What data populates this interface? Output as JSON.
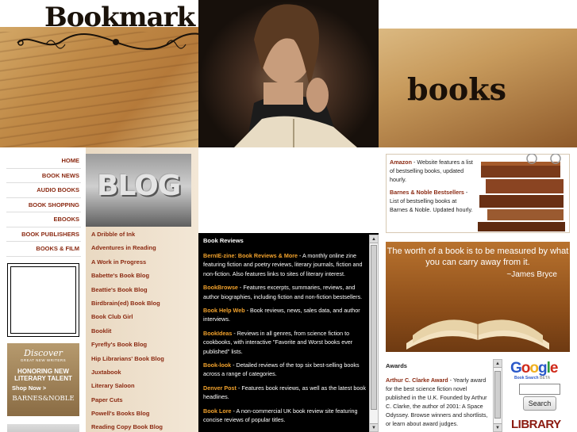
{
  "header": {
    "logo": "Bookmark",
    "right_word": "books"
  },
  "nav": {
    "items": [
      "HOME",
      "BOOK NEWS",
      "AUDIO BOOKS",
      "BOOK SHOPPING",
      "EBOOKS",
      "BOOK PUBLISHERS",
      "BOOKS & FILM"
    ]
  },
  "discover_ad": {
    "heading": "Discover",
    "subheading": "GREAT NEW WRITERS",
    "tagline": "HONORING NEW LITERARY TALENT",
    "cta": "Shop Now >",
    "brand": "BARNES&NOBLE"
  },
  "blog": {
    "image_text": "BLOG",
    "links": [
      "A Dribble of Ink",
      "Adventures in Reading",
      "A Work in Progress",
      "Babette's Book Blog",
      "Beattie's Book Blog",
      "Birdbrain(ed) Book Blog",
      "Book Club Girl",
      "Booklit",
      "Fyrefly's Book Blog",
      "Hip Librarians' Book Blog",
      "Juxtabook",
      "Literary Saloon",
      "Paper Cuts",
      "Powell's Books Blog",
      "Reading Copy Book Blog"
    ]
  },
  "reviews": {
    "title": "Book Reviews",
    "entries": [
      {
        "name": "BernIE-zine: Book Reviews & More",
        "text": " - A monthly online zine featuring fiction and poetry reviews, literary journals, fiction and non-fiction. Also features links to sites of literary interest."
      },
      {
        "name": "BookBrowse",
        "text": " - Features excerpts, summaries, reviews, and author biographies, including fiction and non-fiction bestsellers."
      },
      {
        "name": "Book Help Web",
        "text": " - Book reviews, news, sales data, and author interviews."
      },
      {
        "name": "BookIdeas",
        "text": " - Reviews in all genres, from science fiction to cookbooks, with interactive \"Favorite and Worst books ever published\" lists."
      },
      {
        "name": "Book-look",
        "text": " - Detailed reviews of the top six best-selling books across a range of categories."
      },
      {
        "name": "Denver Post",
        "text": " - Features book reviews, as well as the latest book headlines."
      },
      {
        "name": "Book Lore",
        "text": " - A non-commercial UK book review site featuring concise reviews of popular titles."
      }
    ]
  },
  "shops": {
    "entries": [
      {
        "name": "Amazon",
        "text": " - Website features a list of bestselling books, updated hourly."
      },
      {
        "name": "Barnes & Noble Bestsellers",
        "text": " - List of bestselling books at Barnes & Noble. Updated hourly."
      }
    ]
  },
  "quote": {
    "text": "The worth of a book is to be measured by what you can carry away from it.",
    "author": "~James Bryce"
  },
  "awards": {
    "title": "Awards",
    "entries": [
      {
        "name": "Arthur C. Clarke Award",
        "text": " - Yearly award for the best science fiction novel published in the U.K. Founded by Arthur C. Clarke, the author of 2001: A Space Odyssey. Browse winners and shortlists, or learn about award judges."
      }
    ]
  },
  "google": {
    "logo": "Google",
    "sub": "Book Search",
    "beta": "BETA",
    "search_label": "Search",
    "search_value": ""
  },
  "library_banner": "LIBRARY",
  "colors": {
    "link": "#8b2a12",
    "review_link": "#f2a22c",
    "reviews_bg": "#000000"
  }
}
